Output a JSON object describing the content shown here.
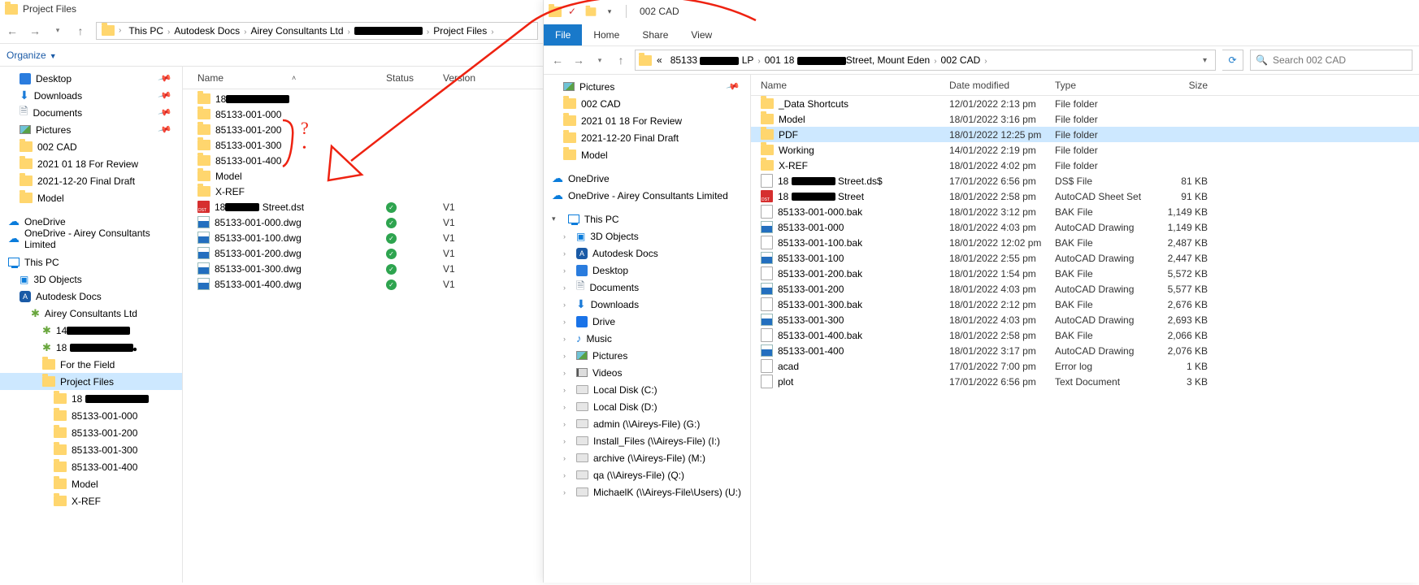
{
  "left": {
    "title": "Project Files",
    "breadcrumbs": [
      "This PC",
      "Autodesk Docs",
      "Airey Consultants Ltd",
      "██████████████",
      "Project Files"
    ],
    "cmdbar": {
      "organize": "Organize"
    },
    "columns": {
      "name": "Name",
      "status": "Status",
      "version": "Version"
    },
    "tree_quick": [
      {
        "label": "Desktop",
        "icon": "desktop",
        "pin": true
      },
      {
        "label": "Downloads",
        "icon": "dl",
        "pin": true
      },
      {
        "label": "Documents",
        "icon": "docs",
        "pin": true
      },
      {
        "label": "Pictures",
        "icon": "pic",
        "pin": true
      },
      {
        "label": "002 CAD",
        "icon": "folder"
      },
      {
        "label": "2021 01 18 For Review",
        "icon": "folder"
      },
      {
        "label": "2021-12-20 Final Draft",
        "icon": "folder"
      },
      {
        "label": "Model",
        "icon": "folder"
      }
    ],
    "tree_onedrive": [
      {
        "label": "OneDrive",
        "icon": "cloud"
      },
      {
        "label": "OneDrive - Airey Consultants Limited",
        "icon": "cloud"
      }
    ],
    "tree_thispc": {
      "label": "This PC"
    },
    "tree_pc_children": [
      {
        "label": "3D Objects",
        "icon": "cube"
      },
      {
        "label": "Autodesk Docs",
        "icon": "acc"
      }
    ],
    "tree_adocs": [
      {
        "label": "Airey Consultants Ltd",
        "icon": "net"
      },
      {
        "label": "14█████████████",
        "icon": "net"
      },
      {
        "label": "18 █████████████",
        "icon": "net"
      },
      {
        "label": "For the Field",
        "icon": "folder"
      },
      {
        "label": "Project Files",
        "icon": "folder",
        "sel": true
      },
      {
        "label": "18 █████████████",
        "icon": "folder"
      },
      {
        "label": "85133-001-000",
        "icon": "folder"
      },
      {
        "label": "85133-001-200",
        "icon": "folder"
      },
      {
        "label": "85133-001-300",
        "icon": "folder"
      },
      {
        "label": "85133-001-400",
        "icon": "folder"
      },
      {
        "label": "Model",
        "icon": "folder"
      },
      {
        "label": "X-REF",
        "icon": "folder",
        "cut": true
      }
    ],
    "files": [
      {
        "name": "18█████████████",
        "icon": "folder"
      },
      {
        "name": "85133-001-000",
        "icon": "folder"
      },
      {
        "name": "85133-001-200",
        "icon": "folder"
      },
      {
        "name": "85133-001-300",
        "icon": "folder"
      },
      {
        "name": "85133-001-400",
        "icon": "folder"
      },
      {
        "name": "Model",
        "icon": "folder"
      },
      {
        "name": "X-REF",
        "icon": "folder"
      },
      {
        "name": "18███████ Street.dst",
        "icon": "dst",
        "status": "ok",
        "version": "V1"
      },
      {
        "name": "85133-001-000.dwg",
        "icon": "dwg",
        "status": "ok",
        "version": "V1"
      },
      {
        "name": "85133-001-100.dwg",
        "icon": "dwg",
        "status": "ok",
        "version": "V1"
      },
      {
        "name": "85133-001-200.dwg",
        "icon": "dwg",
        "status": "ok",
        "version": "V1"
      },
      {
        "name": "85133-001-300.dwg",
        "icon": "dwg",
        "status": "ok",
        "version": "V1"
      },
      {
        "name": "85133-001-400.dwg",
        "icon": "dwg",
        "status": "ok",
        "version": "V1"
      }
    ]
  },
  "right": {
    "title": "002 CAD",
    "tabs": {
      "file": "File",
      "home": "Home",
      "share": "Share",
      "view": "View"
    },
    "breadcrumbs_prefix": "«",
    "breadcrumbs": [
      "85133 ████████ LP",
      "001  18 ██████████Street, Mount Eden",
      "002 CAD"
    ],
    "search_placeholder": "Search 002 CAD",
    "columns": {
      "name": "Name",
      "date": "Date modified",
      "type": "Type",
      "size": "Size"
    },
    "tree_quick": [
      {
        "label": "Pictures",
        "icon": "pic",
        "pin": true
      },
      {
        "label": "002 CAD",
        "icon": "folder"
      },
      {
        "label": "2021 01 18 For Review",
        "icon": "folder"
      },
      {
        "label": "2021-12-20 Final Draft",
        "icon": "folder"
      },
      {
        "label": "Model",
        "icon": "folder"
      }
    ],
    "tree_onedrive": [
      {
        "label": "OneDrive",
        "icon": "cloud"
      },
      {
        "label": "OneDrive - Airey Consultants Limited",
        "icon": "cloud"
      }
    ],
    "tree_thispc": {
      "label": "This PC"
    },
    "tree_pc_children": [
      {
        "label": "3D Objects",
        "icon": "cube"
      },
      {
        "label": "Autodesk Docs",
        "icon": "acc"
      },
      {
        "label": "Desktop",
        "icon": "desktop"
      },
      {
        "label": "Documents",
        "icon": "docs"
      },
      {
        "label": "Downloads",
        "icon": "dl"
      },
      {
        "label": "Drive",
        "icon": "blue"
      },
      {
        "label": "Music",
        "icon": "music"
      },
      {
        "label": "Pictures",
        "icon": "pic"
      },
      {
        "label": "Videos",
        "icon": "video"
      },
      {
        "label": "Local Disk (C:)",
        "icon": "drive"
      },
      {
        "label": "Local Disk (D:)",
        "icon": "drive"
      },
      {
        "label": "admin (\\\\Aireys-File) (G:)",
        "icon": "drive"
      },
      {
        "label": "Install_Files (\\\\Aireys-File) (I:)",
        "icon": "drive"
      },
      {
        "label": "archive (\\\\Aireys-File) (M:)",
        "icon": "drive"
      },
      {
        "label": "qa (\\\\Aireys-File) (Q:)",
        "icon": "drive"
      },
      {
        "label": "MichaelK (\\\\Aireys-File\\Users) (U:)",
        "icon": "drive"
      }
    ],
    "files": [
      {
        "name": "_Data Shortcuts",
        "icon": "folder",
        "date": "12/01/2022 2:13 pm",
        "type": "File folder",
        "size": ""
      },
      {
        "name": "Model",
        "icon": "folder",
        "date": "18/01/2022 3:16 pm",
        "type": "File folder",
        "size": ""
      },
      {
        "name": "PDF",
        "icon": "folder",
        "date": "18/01/2022 12:25 pm",
        "type": "File folder",
        "size": "",
        "sel": true
      },
      {
        "name": "Working",
        "icon": "folder",
        "date": "14/01/2022 2:19 pm",
        "type": "File folder",
        "size": ""
      },
      {
        "name": "X-REF",
        "icon": "folder",
        "date": "18/01/2022 4:02 pm",
        "type": "File folder",
        "size": ""
      },
      {
        "name": "18 █████████ Street.ds$",
        "icon": "file",
        "date": "17/01/2022 6:56 pm",
        "type": "DS$ File",
        "size": "81 KB"
      },
      {
        "name": "18 █████████ Street",
        "icon": "dst",
        "date": "18/01/2022 2:58 pm",
        "type": "AutoCAD Sheet Set",
        "size": "91 KB"
      },
      {
        "name": "85133-001-000.bak",
        "icon": "file",
        "date": "18/01/2022 3:12 pm",
        "type": "BAK File",
        "size": "1,149 KB"
      },
      {
        "name": "85133-001-000",
        "icon": "dwg",
        "date": "18/01/2022 4:03 pm",
        "type": "AutoCAD Drawing",
        "size": "1,149 KB"
      },
      {
        "name": "85133-001-100.bak",
        "icon": "file",
        "date": "18/01/2022 12:02 pm",
        "type": "BAK File",
        "size": "2,487 KB"
      },
      {
        "name": "85133-001-100",
        "icon": "dwg",
        "date": "18/01/2022 2:55 pm",
        "type": "AutoCAD Drawing",
        "size": "2,447 KB"
      },
      {
        "name": "85133-001-200.bak",
        "icon": "file",
        "date": "18/01/2022 1:54 pm",
        "type": "BAK File",
        "size": "5,572 KB"
      },
      {
        "name": "85133-001-200",
        "icon": "dwg",
        "date": "18/01/2022 4:03 pm",
        "type": "AutoCAD Drawing",
        "size": "5,577 KB"
      },
      {
        "name": "85133-001-300.bak",
        "icon": "file",
        "date": "18/01/2022 2:12 pm",
        "type": "BAK File",
        "size": "2,676 KB"
      },
      {
        "name": "85133-001-300",
        "icon": "dwg",
        "date": "18/01/2022 4:03 pm",
        "type": "AutoCAD Drawing",
        "size": "2,693 KB"
      },
      {
        "name": "85133-001-400.bak",
        "icon": "file",
        "date": "18/01/2022 2:58 pm",
        "type": "BAK File",
        "size": "2,066 KB"
      },
      {
        "name": "85133-001-400",
        "icon": "dwg",
        "date": "18/01/2022 3:17 pm",
        "type": "AutoCAD Drawing",
        "size": "2,076 KB"
      },
      {
        "name": "acad",
        "icon": "file",
        "date": "17/01/2022 7:00 pm",
        "type": "Error log",
        "size": "1 KB"
      },
      {
        "name": "plot",
        "icon": "file",
        "date": "17/01/2022 6:56 pm",
        "type": "Text Document",
        "size": "3 KB"
      }
    ]
  },
  "annotation": {
    "q": "?"
  }
}
